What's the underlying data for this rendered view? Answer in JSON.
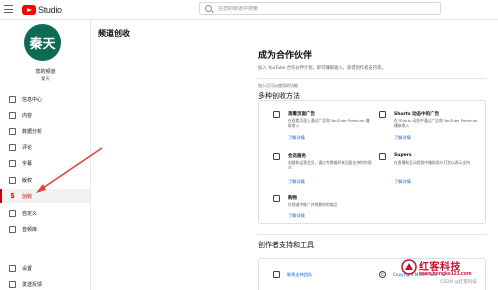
{
  "topbar": {
    "brand": "Studio",
    "search_placeholder": "在您的频道中搜索"
  },
  "sidebar": {
    "avatar_text": "秦天",
    "channel_label": "您的频道",
    "channel_name": "秦天",
    "items": [
      {
        "label": "信息中心",
        "icon": "dashboard-icon"
      },
      {
        "label": "内容",
        "icon": "content-icon"
      },
      {
        "label": "数据分析",
        "icon": "analytics-icon"
      },
      {
        "label": "评论",
        "icon": "comments-icon"
      },
      {
        "label": "字幕",
        "icon": "subtitles-icon"
      },
      {
        "label": "版权",
        "icon": "copyright-icon"
      },
      {
        "label": "创收",
        "icon": "monetization-icon",
        "active": true,
        "icon_glyph": "$"
      },
      {
        "label": "自定义",
        "icon": "customization-icon"
      },
      {
        "label": "音频库",
        "icon": "audio-library-icon"
      },
      {
        "label": "设置",
        "icon": "settings-icon"
      },
      {
        "label": "发送反馈",
        "icon": "feedback-icon"
      }
    ]
  },
  "main": {
    "page_title": "频道创收",
    "heading": "成为合作伙伴",
    "description": "加入 YouTube 合作伙伴计划，即可赚取收入，获得创作者支持等。",
    "intro_small": "加入后可以使用的功能",
    "methods_heading": "多种创收方法",
    "options": [
      {
        "icon": "watch-page-ads-icon",
        "title": "观看页面广告",
        "desc": "在观看页面上通过广告和 YouTube Premium 赚取收入",
        "link": "了解详情"
      },
      {
        "icon": "shorts-feed-ads-icon",
        "title": "Shorts 动态中的广告",
        "desc": "在 Shorts 动态中通过广告和 YouTube Premium 赚取收入",
        "link": "了解详情"
      },
      {
        "icon": "memberships-icon",
        "title": "会员服务",
        "desc": "创建和运营会员，通过专属福利来回报支持你的观众",
        "link": "了解详情"
      },
      {
        "icon": "supers-icon",
        "title": "Supers",
        "desc": "在直播和互动视频中赚取观众打赏以表示支持",
        "link": "了解详情"
      },
      {
        "icon": "shopping-icon",
        "title": "购物",
        "desc": "在频道中推广并销售你的商品",
        "link": "了解详情"
      }
    ],
    "support_heading": "创作者支持和工具",
    "support_items": [
      {
        "icon": "support-icon",
        "label": "联系支持团队"
      },
      {
        "icon": "copyright-match-icon",
        "label": "Copyright Match Tool"
      }
    ]
  },
  "watermark": {
    "title": "红客科技",
    "url": "www.hongke123.com",
    "csdn": "CSDN @红客科技"
  },
  "colors": {
    "accent": "#cc0000",
    "link": "#065fd4",
    "avatar": "#0d6b54",
    "annotation_arrow": "#e0443a"
  }
}
